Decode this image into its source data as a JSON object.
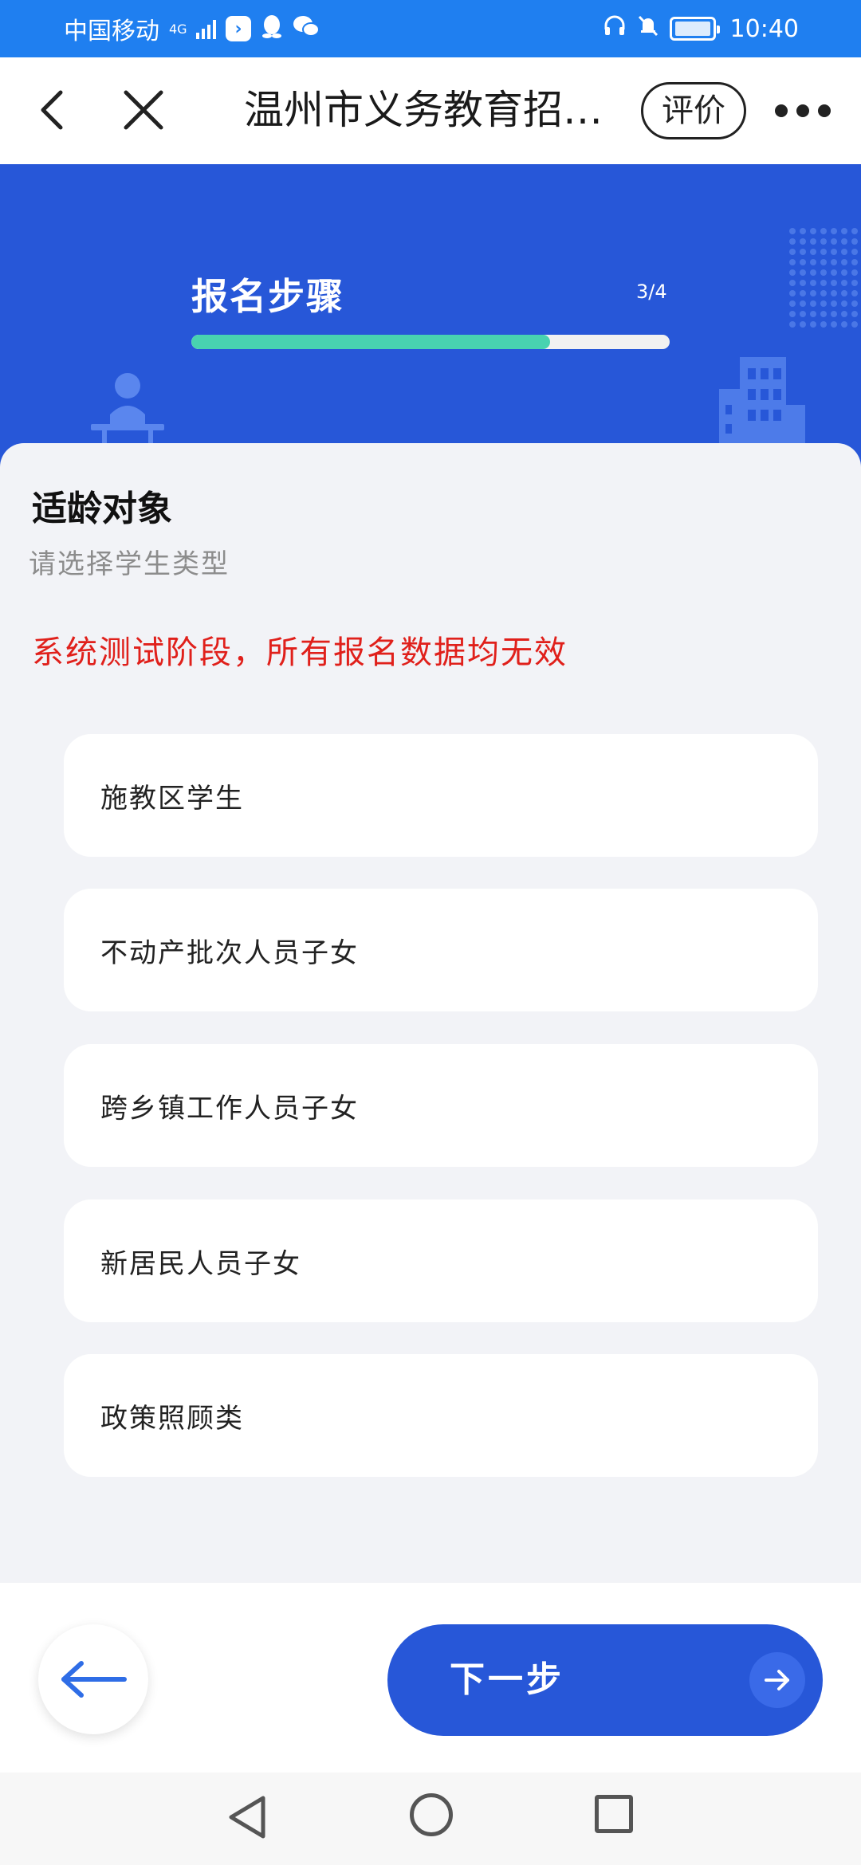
{
  "status_bar": {
    "carrier": "中国移动",
    "network": "4G",
    "time": "10:40",
    "icons": [
      "signal-icon",
      "app-icon",
      "qq-icon",
      "wechat-icon",
      "headphones-icon",
      "mute-bell-icon",
      "battery-icon"
    ]
  },
  "nav": {
    "title": "温州市义务教育招…",
    "rate_label": "评价",
    "icons": [
      "back-icon",
      "close-icon",
      "more-icon"
    ]
  },
  "hero": {
    "step_title": "报名步骤",
    "step_count": "3/4",
    "progress": 0.75,
    "colors": {
      "background": "#2757d8",
      "progress_fill": "#48d3b0",
      "progress_track": "#f1f1f1"
    }
  },
  "content": {
    "title": "适龄对象",
    "subtitle": "请选择学生类型",
    "notice": "系统测试阶段，所有报名数据均无效",
    "notice_color": "#e0201b",
    "options": [
      {
        "label": "施教区学生"
      },
      {
        "label": "不动产批次人员子女"
      },
      {
        "label": "跨乡镇工作人员子女"
      },
      {
        "label": "新居民人员子女"
      },
      {
        "label": "政策照顾类"
      }
    ]
  },
  "footer": {
    "next_label": "下一步",
    "accent": "#2757d8",
    "icons": [
      "arrow-left-icon",
      "arrow-right-icon"
    ]
  },
  "system_nav": {
    "icons": [
      "triangle-back-icon",
      "circle-home-icon",
      "square-recent-icon"
    ]
  }
}
